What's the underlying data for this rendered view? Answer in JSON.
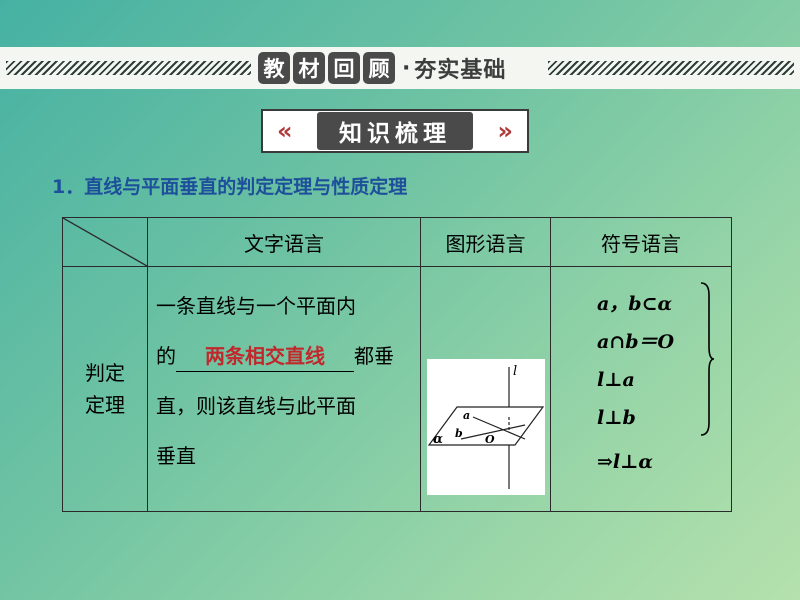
{
  "banner": {
    "badges": [
      "教",
      "材",
      "回",
      "顾"
    ],
    "dot": "·",
    "subtitle": "夯实基础"
  },
  "section": {
    "title": "知识梳理"
  },
  "item": {
    "title": "1．直线与平面垂直的判定定理与性质定理"
  },
  "table": {
    "headers": [
      "文字语言",
      "图形语言",
      "符号语言"
    ],
    "row_label_line1": "判定",
    "row_label_line2": "定理",
    "text_part1": "一条直线与一个平面内",
    "text_prefix": "的",
    "text_blank": "两条相交直线",
    "text_suffix": "都垂",
    "text_part3": "直，则该直线与此平面",
    "text_part4": "垂直",
    "figure_labels": {
      "l": "l",
      "a": "a",
      "b": "b",
      "O": "O",
      "alpha": "α"
    },
    "symbols": [
      "a，b⊂α",
      "a∩b＝O",
      "l⊥a",
      "l⊥b"
    ],
    "symbol_result": "⇒l⊥α"
  },
  "colors": {
    "heading_blue": "#1d4f9a",
    "answer_red": "#c0282c",
    "badge_dark": "#4a4a4a"
  }
}
